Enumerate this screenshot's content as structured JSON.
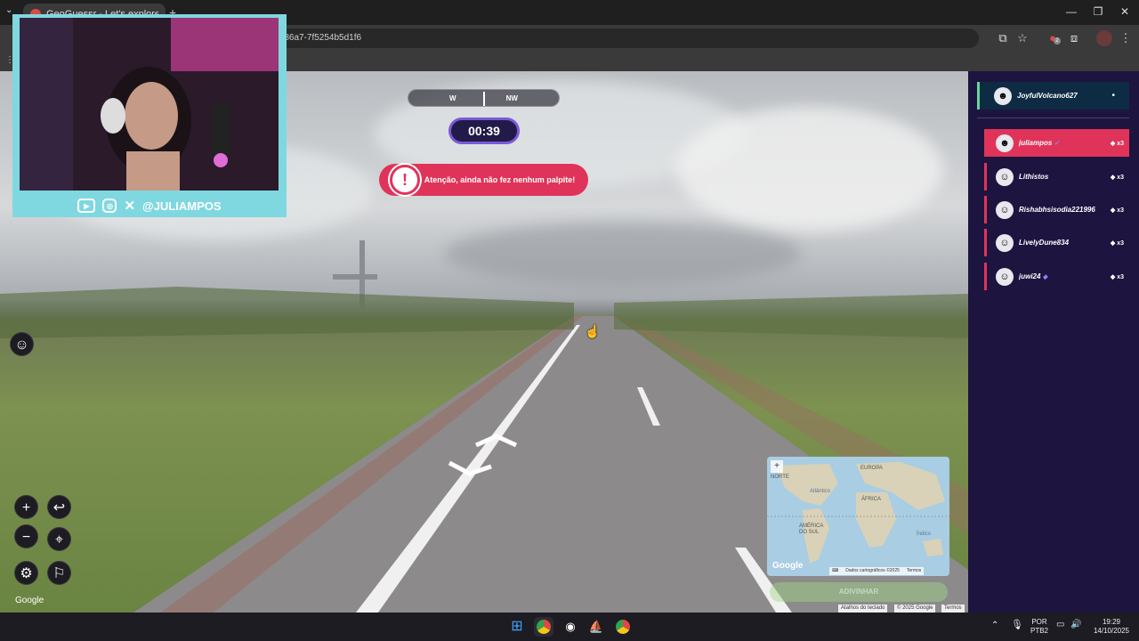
{
  "browser": {
    "tab_title": "GeoGuessr - Let's explore",
    "url_fragment": "-86a7-7f5254b5d1f6",
    "new_tab": "+",
    "win_minimize": "—",
    "win_restore": "❐",
    "win_close": "✕",
    "extension_badge": "2"
  },
  "game": {
    "compass_left": "W",
    "compass_right": "NW",
    "timer": "00:39",
    "alert": "Atenção, ainda não fez nenhum palpite!",
    "alert_icon_glyph": "!",
    "google_watermark": "Google",
    "guess_button": "ADIVINHAR",
    "attribution": [
      "Atalhos do teclado",
      "© 2025 Google",
      "Termos"
    ],
    "minimap": {
      "labels": [
        "EUROPA",
        "ÁFRICA",
        "AMÉRICA DO SUL",
        "NORTE",
        "Atlântico",
        "Índico"
      ],
      "google": "Google",
      "footer": [
        "Dados cartográficos ©2025",
        "Termos"
      ],
      "zoom": "+"
    },
    "controls": {
      "zoom_in": "+",
      "zoom_out": "−",
      "back": "↩",
      "emoji": "☺"
    }
  },
  "streamer": {
    "handle": "@JULIAMPOS"
  },
  "players": {
    "self": {
      "name": "JoyfulVolcano627",
      "status": "•"
    },
    "list": [
      {
        "name": "juliampos",
        "score": "x3",
        "verified": "✓"
      },
      {
        "name": "Lithistos",
        "score": "x3"
      },
      {
        "name": "Rishabhsisodia221996",
        "score": "x3"
      },
      {
        "name": "LivelyDune834",
        "score": "x3"
      },
      {
        "name": "juwi24",
        "score": "x3",
        "verified": "◆"
      }
    ]
  },
  "taskbar": {
    "lang": "POR",
    "layout": "PTB2",
    "time": "19:29",
    "date": "14/10/2025",
    "chevron": "⌃"
  },
  "colors": {
    "accent_pink": "#e0335a",
    "timer_purple": "#7b59d8",
    "panel_bg": "#1e1440",
    "cam_frame": "#7fd8e0"
  }
}
